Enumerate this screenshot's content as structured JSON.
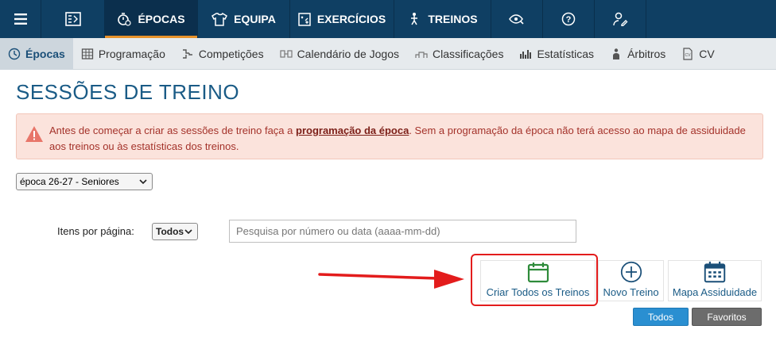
{
  "topnav": {
    "items": [
      {
        "name": "menu",
        "label": ""
      },
      {
        "name": "logo",
        "label": ""
      },
      {
        "name": "epocas",
        "label": "ÉPOCAS"
      },
      {
        "name": "equipa",
        "label": "EQUIPA"
      },
      {
        "name": "exercicios",
        "label": "EXERCÍCIOS"
      },
      {
        "name": "treinos",
        "label": "TREINOS"
      }
    ]
  },
  "subnav": {
    "items": [
      {
        "label": "Épocas"
      },
      {
        "label": "Programação"
      },
      {
        "label": "Competições"
      },
      {
        "label": "Calendário de Jogos"
      },
      {
        "label": "Classificações"
      },
      {
        "label": "Estatísticas"
      },
      {
        "label": "Árbitros"
      },
      {
        "label": "CV"
      }
    ]
  },
  "page": {
    "title": "SESSÕES DE TREINO"
  },
  "alert": {
    "before": "Antes de começar a criar as sessões de treino faça a ",
    "link": "programação da época",
    "after": ". Sem a programação da época não terá acesso ao mapa de assiduidade aos treinos ou às estatísticas dos treinos."
  },
  "season_select": {
    "value": "época 26-27 - Seniores"
  },
  "pagination": {
    "label": "Itens por página:",
    "value": "Todos"
  },
  "search": {
    "placeholder": "Pesquisa por número ou data (aaaa-mm-dd)"
  },
  "actions": {
    "criar": "Criar Todos os Treinos",
    "novo": "Novo Treino",
    "mapa": "Mapa Assiduidade"
  },
  "tabs": {
    "todos": "Todos",
    "favoritos": "Favoritos"
  },
  "colors": {
    "nav": "#0f3f63",
    "accent": "#e8922a",
    "alert_text": "#a4322a",
    "highlight": "#e31c1c",
    "tab_active": "#2a8fd1"
  }
}
